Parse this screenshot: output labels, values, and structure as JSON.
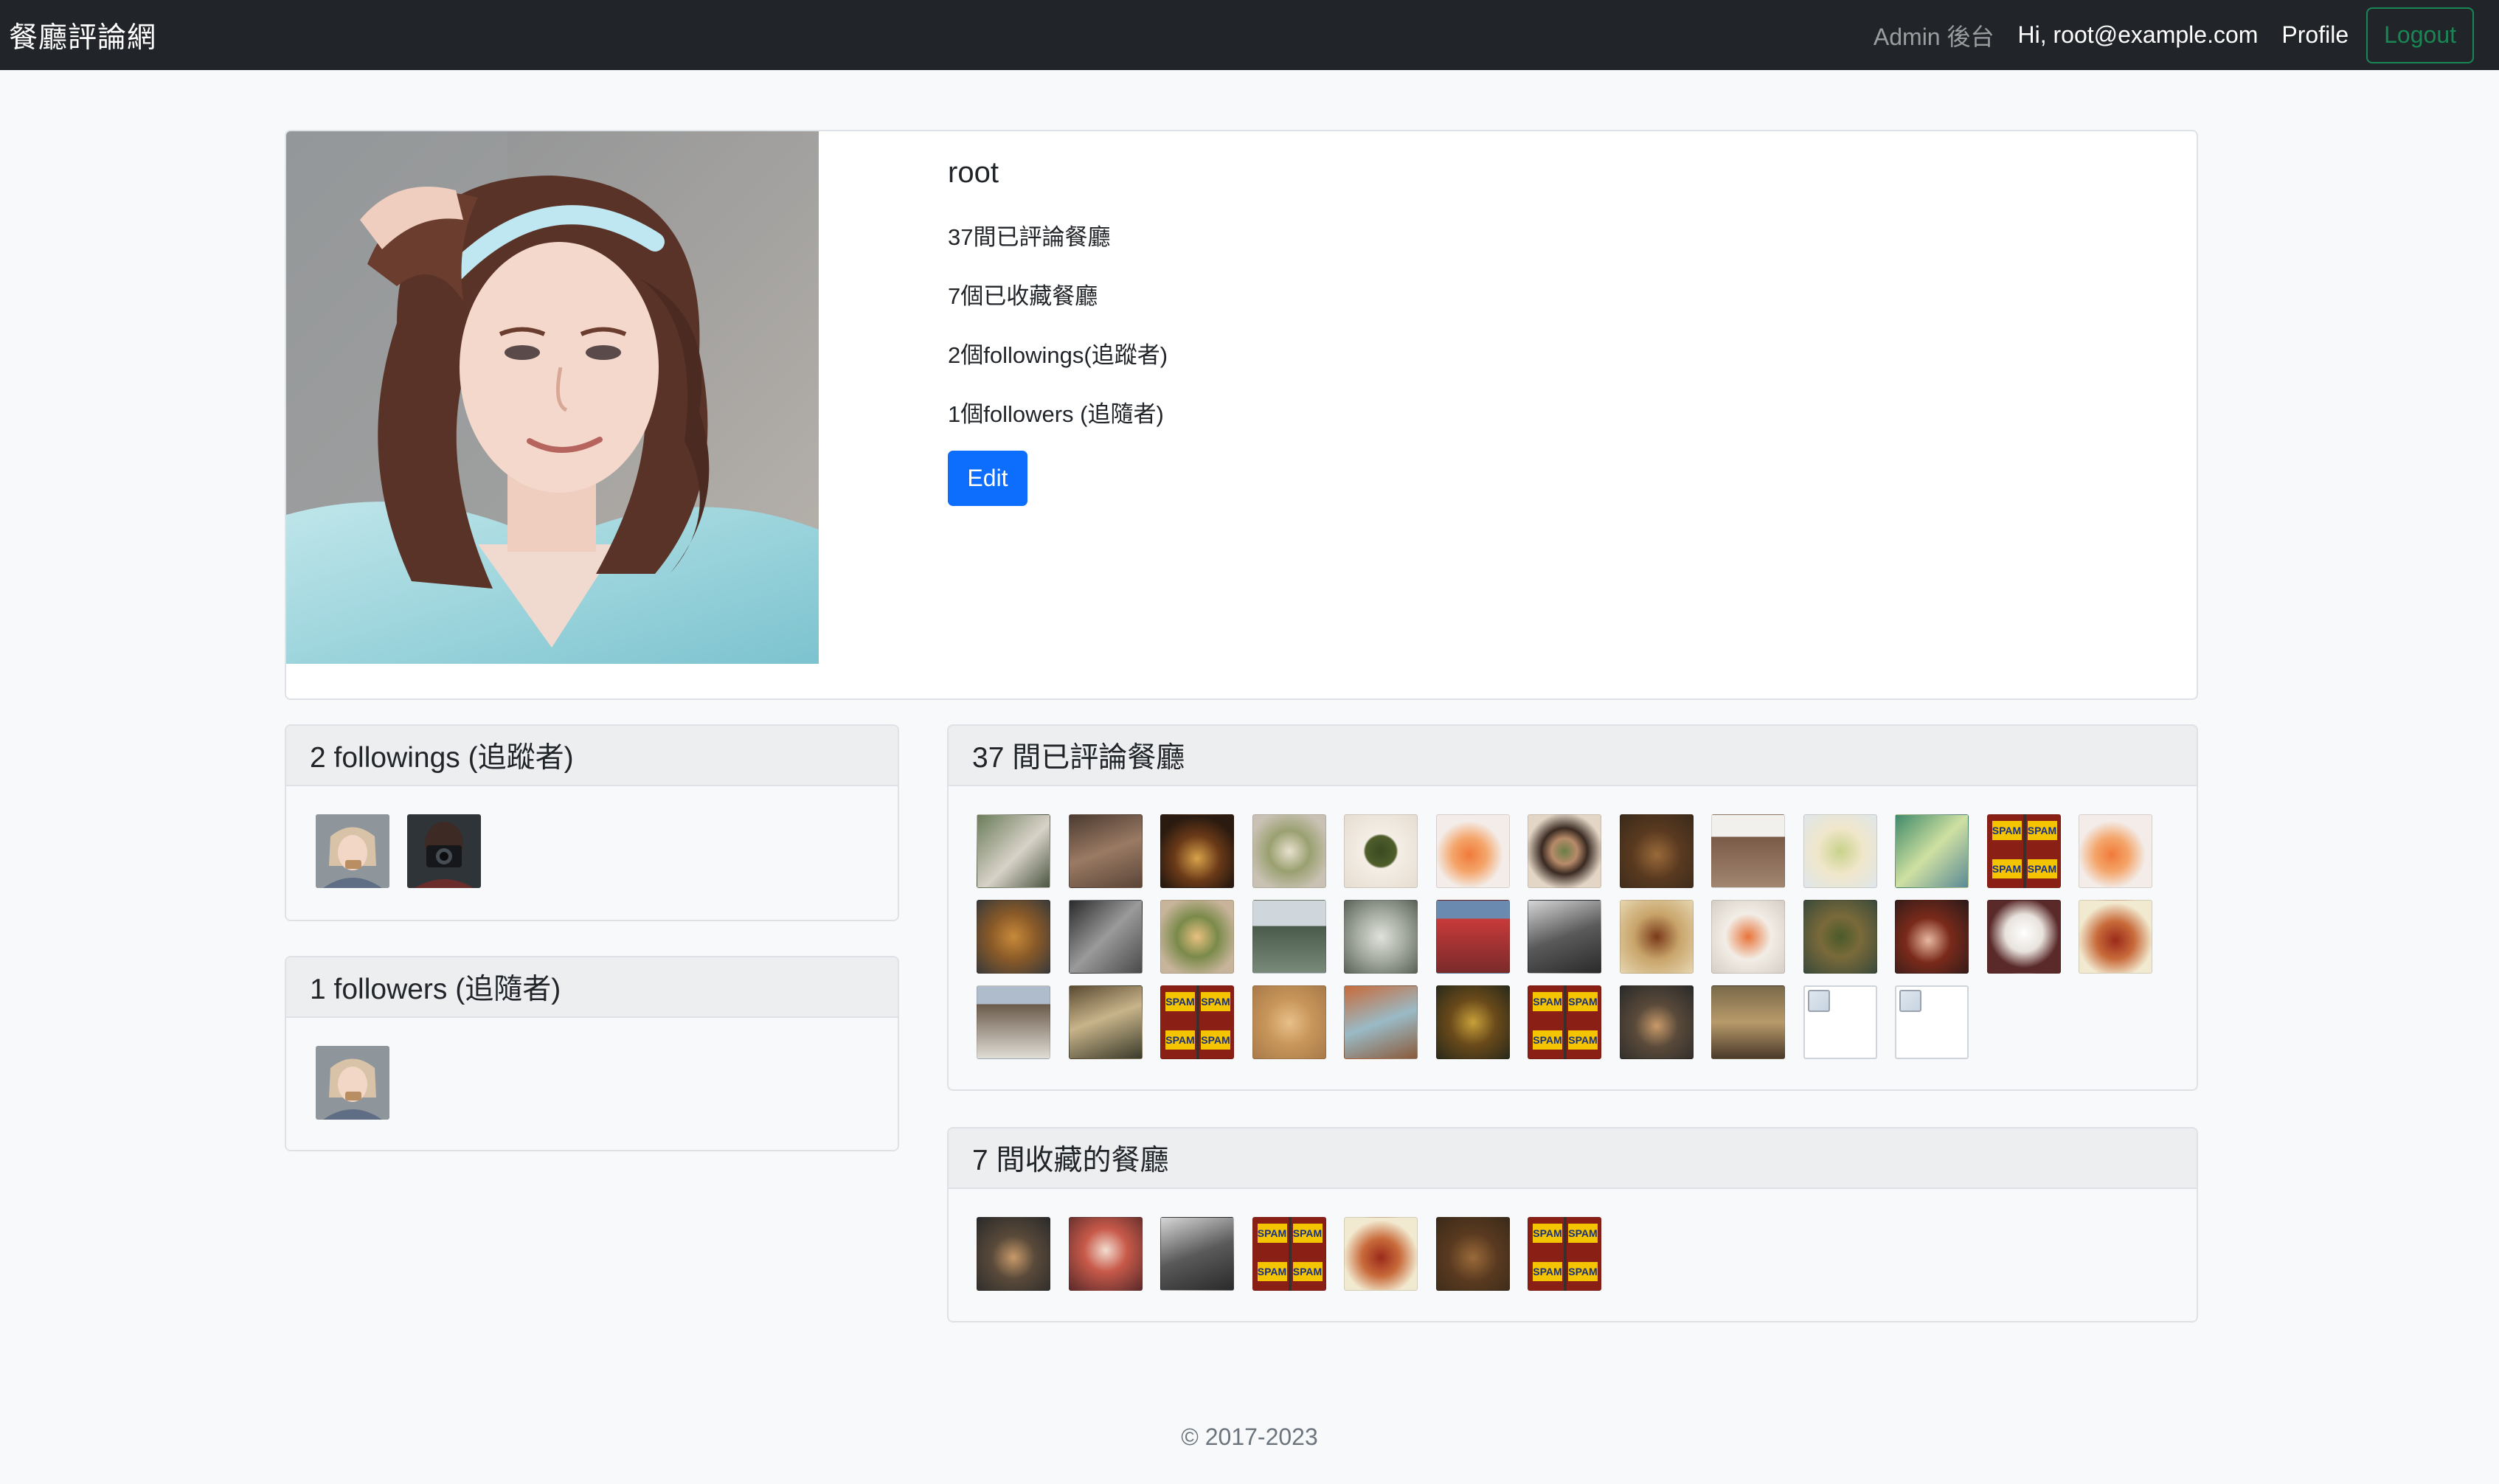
{
  "navbar": {
    "brand": "餐廳評論網",
    "admin_link": "Admin 後台",
    "greeting": "Hi, root@example.com",
    "profile_link": "Profile",
    "logout": "Logout"
  },
  "profile": {
    "name": "root",
    "stats": [
      "37間已評論餐廳",
      "7個已收藏餐廳",
      "2個followings(追蹤者)",
      "1個followers (追隨者)"
    ],
    "edit_label": "Edit"
  },
  "followings": {
    "title": "2 followings (追蹤者)"
  },
  "followers": {
    "title": "1 followers (追隨者)"
  },
  "reviewed": {
    "title": "37 間已評論餐廳",
    "spam_label": "SPAM"
  },
  "favorites": {
    "title": "7 間收藏的餐廳"
  },
  "footer": {
    "copyright": "© 2017-2023"
  },
  "colors": {
    "navbar_bg": "#212529",
    "primary": "#0d6efd",
    "success": "#198754",
    "page_bg": "#f8f9fa"
  }
}
